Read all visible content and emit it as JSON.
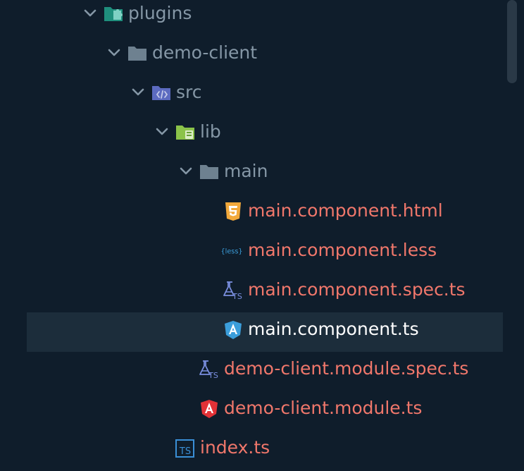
{
  "tree": {
    "rows": [
      {
        "label": "plugins",
        "icon": "plugins-folder-icon",
        "expanded": true
      },
      {
        "label": "demo-client",
        "icon": "folder-icon",
        "expanded": true
      },
      {
        "label": "src",
        "icon": "src-folder-icon",
        "expanded": true
      },
      {
        "label": "lib",
        "icon": "lib-folder-icon",
        "expanded": true
      },
      {
        "label": "main",
        "icon": "folder-icon",
        "expanded": true
      },
      {
        "label": "main.component.html",
        "icon": "html5-icon"
      },
      {
        "label": "main.component.less",
        "icon": "less-icon",
        "icon_text": "{less}"
      },
      {
        "label": "main.component.spec.ts",
        "icon": "test-ts-icon",
        "icon_text": "TS"
      },
      {
        "label": "main.component.ts",
        "icon": "angular-component-icon",
        "selected": true
      },
      {
        "label": "demo-client.module.spec.ts",
        "icon": "test-ts-icon",
        "icon_text": "TS"
      },
      {
        "label": "demo-client.module.ts",
        "icon": "angular-module-icon"
      },
      {
        "label": "index.ts",
        "icon": "typescript-icon",
        "icon_text": "TS"
      }
    ]
  },
  "colors": {
    "background": "#0f1d2b",
    "selection": "#1c2d3b",
    "folder_text": "#8597a6",
    "modified_text": "#f0776b",
    "selected_text": "#ffffff",
    "html_icon": "#f2a93b",
    "angular_blue": "#3b9edb",
    "angular_red": "#e23237",
    "ts_blue": "#3a8fd6",
    "lib_green": "#8bc34a",
    "plugins_teal": "#1f8f7d",
    "src_blue": "#5c6bc0"
  }
}
